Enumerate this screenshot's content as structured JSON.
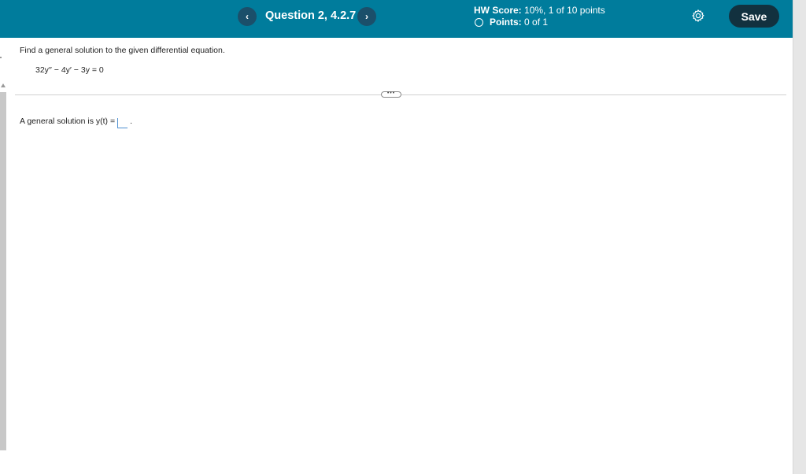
{
  "header": {
    "question_title": "Question 2, 4.2.7",
    "prev_label": "‹",
    "next_label": "›",
    "hw_score_label": "HW Score:",
    "hw_score_value": "10%, 1 of 10 points",
    "points_label": "Points:",
    "points_value": "0 of 1",
    "save_label": "Save",
    "settings_icon": "gear-icon"
  },
  "question": {
    "prompt": "Find a general solution to the given differential equation.",
    "equation": "32y′′ − 4y′ − 3y = 0",
    "more_label": "•••",
    "answer_prefix": "A general solution is y(t) =",
    "answer_value": "",
    "answer_suffix": "."
  },
  "colors": {
    "header_bg": "#007c9c",
    "nav_button": "#1b4f6a",
    "save_button": "#12313f",
    "answer_box": "#4d8fd1"
  }
}
